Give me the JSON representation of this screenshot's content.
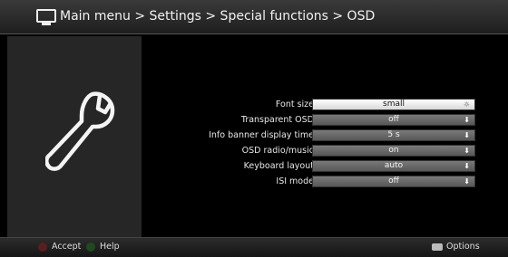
{
  "header": {
    "breadcrumb": "Main menu > Settings > Special functions > OSD"
  },
  "settings": [
    {
      "label": "Font size",
      "value": "small",
      "selected": true
    },
    {
      "label": "Transparent OSD",
      "value": "off",
      "selected": false
    },
    {
      "label": "Info banner display time",
      "value": "5 s",
      "selected": false
    },
    {
      "label": "OSD radio/music",
      "value": "on",
      "selected": false
    },
    {
      "label": "Keyboard layout",
      "value": "auto",
      "selected": false
    },
    {
      "label": "ISI mode",
      "value": "off",
      "selected": false
    }
  ],
  "footer": {
    "accept": "Accept",
    "help": "Help",
    "options": "Options"
  },
  "colors": {
    "selected_bg": "#ffffff",
    "value_bg": "#6a6a6a",
    "accept_dot": "#5a1e1e",
    "help_dot": "#1f4a1f"
  }
}
